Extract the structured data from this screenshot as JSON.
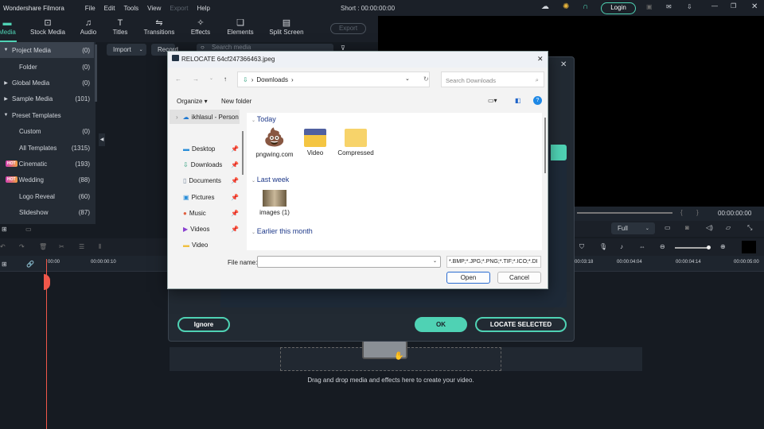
{
  "app": {
    "title": "Wondershare Filmora",
    "menu": [
      "File",
      "Edit",
      "Tools",
      "View",
      "Export",
      "Help"
    ],
    "project_time": "Short : 00:00:00:00",
    "login": "Login"
  },
  "tabs": [
    {
      "label": "Media",
      "icon": "folder-icon"
    },
    {
      "label": "Stock Media",
      "icon": "stock-icon"
    },
    {
      "label": "Audio",
      "icon": "music-icon"
    },
    {
      "label": "Titles",
      "icon": "text-icon"
    },
    {
      "label": "Transitions",
      "icon": "transition-icon"
    },
    {
      "label": "Effects",
      "icon": "effects-icon"
    },
    {
      "label": "Elements",
      "icon": "elements-icon"
    },
    {
      "label": "Split Screen",
      "icon": "split-screen-icon"
    }
  ],
  "export_label": "Export",
  "sidebar": {
    "items": [
      {
        "label": "Project Media",
        "count": "(0)",
        "hot": false,
        "expander": "▼"
      },
      {
        "label": "Folder",
        "count": "(0)",
        "hot": false
      },
      {
        "label": "Global Media",
        "count": "(0)",
        "hot": false,
        "expander": "▶"
      },
      {
        "label": "Sample Media",
        "count": "(101)",
        "hot": false,
        "expander": "▶"
      },
      {
        "label": "Preset Templates",
        "count": "",
        "hot": false,
        "expander": "▼"
      },
      {
        "label": "Custom",
        "count": "(0)",
        "hot": false
      },
      {
        "label": "All Templates",
        "count": "(1315)",
        "hot": false
      },
      {
        "label": "Cinematic",
        "count": "(193)",
        "hot": true
      },
      {
        "label": "Wedding",
        "count": "(88)",
        "hot": true
      },
      {
        "label": "Logo Reveal",
        "count": "(60)",
        "hot": false
      },
      {
        "label": "Slideshow",
        "count": "(87)",
        "hot": false
      }
    ],
    "hot_badge": "HOT"
  },
  "media_toolbar": {
    "import": "Import",
    "record": "Record",
    "search_placeholder": "Search media"
  },
  "player": {
    "time": "00:00:00:00",
    "quality": "Full"
  },
  "timeline": {
    "ticks_left": [
      "00:00",
      "00:00:00:10"
    ],
    "ticks_right": [
      "00:03:18",
      "00:00:04:04",
      "00:00:04:14",
      "00:00:05:00"
    ],
    "drop_hint": "Drag and drop media and effects here to create your video."
  },
  "relocate": {
    "ignore": "Ignore",
    "ok": "OK",
    "locate": "LOCATE SELECTED"
  },
  "file_dialog": {
    "title": "RELOCATE 64cf247366463.jpeg",
    "path": "Downloads",
    "search_placeholder": "Search Downloads",
    "organize": "Organize ▾",
    "new_folder": "New folder",
    "nav": [
      {
        "label": "ikhlasul - Person",
        "icon": "onedrive-icon"
      },
      {
        "label": "Desktop",
        "icon": "desktop-icon"
      },
      {
        "label": "Downloads",
        "icon": "download-icon"
      },
      {
        "label": "Documents",
        "icon": "document-icon"
      },
      {
        "label": "Pictures",
        "icon": "pictures-icon"
      },
      {
        "label": "Music",
        "icon": "music-icon"
      },
      {
        "label": "Videos",
        "icon": "videos-icon"
      },
      {
        "label": "Video",
        "icon": "folder-icon"
      }
    ],
    "groups": {
      "today": "Today",
      "last_week": "Last week",
      "earlier": "Earlier this month"
    },
    "files_today": [
      "pngwing.com",
      "Video",
      "Compressed"
    ],
    "files_last_week": [
      "images (1)"
    ],
    "file_name_label": "File name:",
    "file_name_value": "",
    "filter": "*.BMP;*.JPG;*.PNG;*.TIF;*.ICO;*.DI",
    "open": "Open",
    "cancel": "Cancel"
  },
  "colors": {
    "accent": "#4fd2b4",
    "playhead": "#f0574a"
  }
}
